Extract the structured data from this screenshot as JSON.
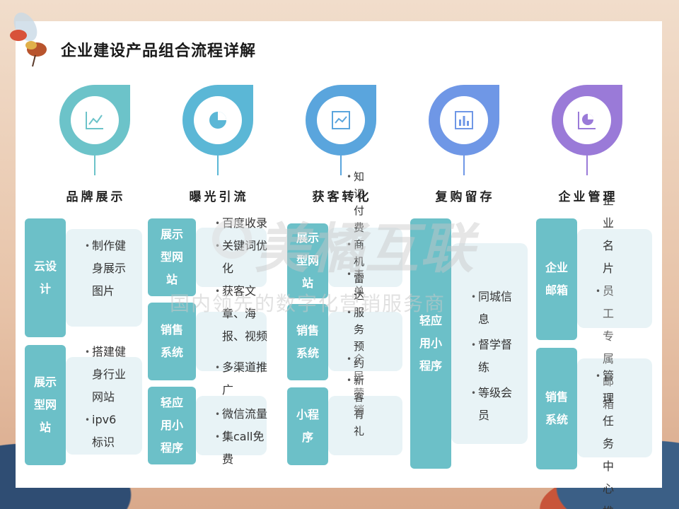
{
  "page": {
    "title": "企业建设产品组合流程详解"
  },
  "watermark": {
    "main": "美橘互联",
    "sub": "国内领先的数字化营销服务商"
  },
  "colors": {
    "stage1": "#6cc3c9",
    "stage2": "#5bb7d6",
    "stage3": "#5aa5dd",
    "stage4": "#6f97e6",
    "stage5": "#9a7ad8",
    "tag": "#6cc0c8"
  },
  "stages": [
    {
      "title": "品牌展示",
      "icon": "line-chart-icon",
      "tags": [
        "云设计",
        "展示型网站"
      ],
      "bullets": [
        "制作健身展示图片",
        "搭建健身行业网站",
        "ipv6标识"
      ]
    },
    {
      "title": "曝光引流",
      "icon": "pie-chart-icon",
      "tags": [
        "展示型网站",
        "销售系统",
        "轻应用小程序"
      ],
      "bullets": [
        "百度收录",
        "关键词优化",
        "获客文章、海报、视频",
        "多渠道推广",
        "微信流量",
        "集call免费"
      ]
    },
    {
      "title": "获客转化",
      "icon": "trend-chart-icon",
      "tags": [
        "展示型网站",
        "销售系统",
        "小程序"
      ],
      "bullets": [
        "知识付费",
        "商机雷达",
        "表单",
        "服务预约",
        "全民营销",
        "新客有礼"
      ]
    },
    {
      "title": "复购留存",
      "icon": "bar-chart-icon",
      "tags": [
        "轻应用小程序"
      ],
      "bullets": [
        "同城信息",
        "督学督练",
        "等级会员"
      ]
    },
    {
      "title": "企业管理",
      "icon": "pie-report-icon",
      "tags": [
        "企业邮箱",
        "销售系统"
      ],
      "bullets": [
        "企业名片",
        "员工专属邮箱",
        "管理任务中心",
        "推"
      ]
    }
  ]
}
